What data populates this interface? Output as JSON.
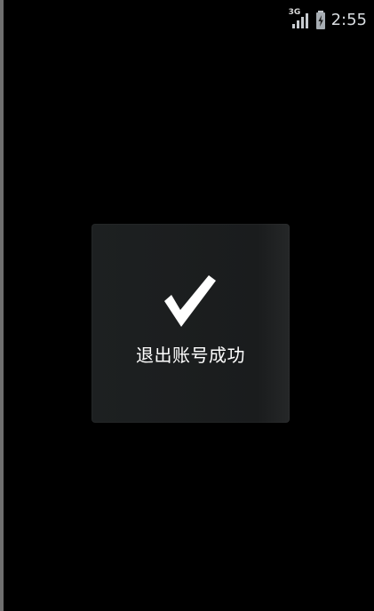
{
  "status_bar": {
    "network_type": "3G",
    "time": "2:55",
    "icons": [
      "signal-3g-icon",
      "battery-charging-icon"
    ]
  },
  "toast": {
    "icon": "check-icon",
    "message": "退出账号成功"
  }
}
